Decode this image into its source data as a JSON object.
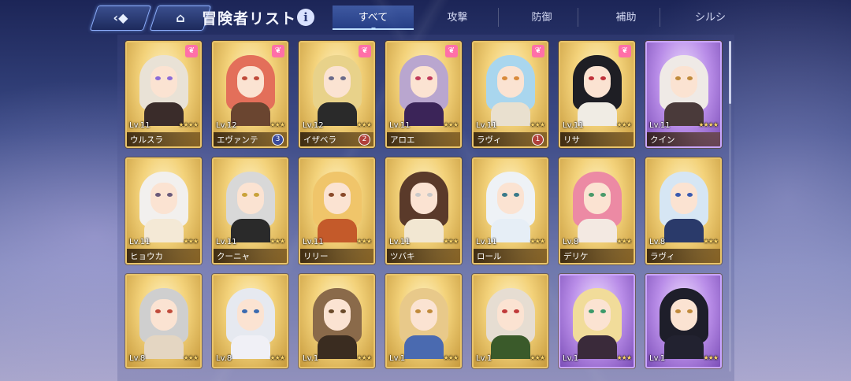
{
  "header": {
    "back_icon": "back-arrow-icon",
    "home_icon": "home-icon",
    "title": "冒険者リスト",
    "info_label": "i"
  },
  "tabs": [
    {
      "label": "すべて",
      "active": true
    },
    {
      "label": "攻撃",
      "active": false
    },
    {
      "label": "防御",
      "active": false
    },
    {
      "label": "補助",
      "active": false
    },
    {
      "label": "シルシ",
      "active": false
    }
  ],
  "cards": [
    {
      "name": "ウルスラ",
      "level": "Lv.11",
      "stars": "★★★★",
      "frame": "gold",
      "paw": true,
      "badge": "",
      "hair": "#e9e2d6",
      "eye": "#8a6ad8",
      "outfit": "#3a2c2a"
    },
    {
      "name": "エヴァンテ",
      "level": "Lv.12",
      "stars": "★★★",
      "frame": "gold",
      "paw": true,
      "badge": "3",
      "badge_color": "#3a4a9a",
      "hair": "#e36f5a",
      "eye": "#c04a3a",
      "outfit": "#6a4530"
    },
    {
      "name": "イザベラ",
      "level": "Lv.12",
      "stars": "★★★",
      "frame": "gold",
      "paw": true,
      "badge": "2",
      "badge_color": "#b0403a",
      "hair": "#e8d28a",
      "eye": "#6a6a8a",
      "outfit": "#2a2a2a"
    },
    {
      "name": "アロエ",
      "level": "Lv.11",
      "stars": "★★★",
      "frame": "gold",
      "paw": true,
      "badge": "",
      "hair": "#b9a6cf",
      "eye": "#c23a5a",
      "outfit": "#3b2458"
    },
    {
      "name": "ラヴィ",
      "level": "Lv.11",
      "stars": "★★★",
      "frame": "gold",
      "paw": true,
      "badge": "1",
      "badge_color": "#b0403a",
      "hair": "#a9d6ee",
      "eye": "#d98a3a",
      "outfit": "#e9e0cf"
    },
    {
      "name": "リサ",
      "level": "Lv.11",
      "stars": "★★★",
      "frame": "gold",
      "paw": true,
      "badge": "",
      "hair": "#1e1e24",
      "eye": "#c0303a",
      "outfit": "#f0ece4"
    },
    {
      "name": "クイン",
      "level": "Lv.11",
      "stars": "★★★★",
      "frame": "purple",
      "paw": false,
      "badge": "",
      "hair": "#efeae6",
      "eye": "#c08a3a",
      "outfit": "#4a3a3a"
    },
    {
      "name": "ヒョウカ",
      "level": "Lv.11",
      "stars": "★★★",
      "frame": "gold",
      "paw": false,
      "badge": "",
      "hair": "#f2f0ee",
      "eye": "#6a5a7a",
      "outfit": "#f4e9d6"
    },
    {
      "name": "クーニャ",
      "level": "Lv.11",
      "stars": "★★★",
      "frame": "gold",
      "paw": false,
      "badge": "",
      "hair": "#d8d8d8",
      "eye": "#c9a23a",
      "outfit": "#2a2a2a"
    },
    {
      "name": "リリー",
      "level": "Lv.11",
      "stars": "★★★",
      "frame": "gold",
      "paw": false,
      "badge": "",
      "hair": "#f0c56a",
      "eye": "#8a4a2a",
      "outfit": "#c45a2a"
    },
    {
      "name": "ツバキ",
      "level": "Lv.11",
      "stars": "★★★",
      "frame": "gold",
      "paw": false,
      "badge": "",
      "hair": "#5a3a2a",
      "eye": "#c9c9c9",
      "outfit": "#f2e7d2"
    },
    {
      "name": "ロール",
      "level": "Lv.11",
      "stars": "★★★",
      "frame": "gold",
      "paw": false,
      "badge": "",
      "hair": "#eef2f6",
      "eye": "#3a7a8a",
      "outfit": "#e6eef6"
    },
    {
      "name": "デリケ",
      "level": "Lv.8",
      "stars": "★★★",
      "frame": "gold",
      "paw": false,
      "badge": "",
      "hair": "#ec8aa4",
      "eye": "#4a9a6a",
      "outfit": "#f3e9e2"
    },
    {
      "name": "ラヴィ",
      "level": "Lv.8",
      "stars": "★★★",
      "frame": "gold",
      "paw": false,
      "badge": "",
      "hair": "#d6e6f4",
      "eye": "#3a5ab0",
      "outfit": "#2a3a6a"
    },
    {
      "name": "",
      "level": "Lv.8",
      "stars": "★★★",
      "frame": "gold",
      "paw": false,
      "badge": "",
      "hair": "#cfcfcf",
      "eye": "#c04a3a",
      "outfit": "#e4d6c2"
    },
    {
      "name": "",
      "level": "Lv.8",
      "stars": "★★★",
      "frame": "gold",
      "paw": false,
      "badge": "",
      "hair": "#e6e9f0",
      "eye": "#3a6ab0",
      "outfit": "#f0f0f6"
    },
    {
      "name": "",
      "level": "Lv.1",
      "stars": "★★★",
      "frame": "gold",
      "paw": false,
      "badge": "",
      "hair": "#8a6a4a",
      "eye": "#6a4a2a",
      "outfit": "#3a2c20"
    },
    {
      "name": "",
      "level": "Lv.1",
      "stars": "★★★",
      "frame": "gold",
      "paw": false,
      "badge": "",
      "hair": "#e8c98a",
      "eye": "#c08a3a",
      "outfit": "#4a6ab0"
    },
    {
      "name": "",
      "level": "Lv.1",
      "stars": "★★★",
      "frame": "gold",
      "paw": false,
      "badge": "",
      "hair": "#e6ddd2",
      "eye": "#c03a3a",
      "outfit": "#3a5a2a"
    },
    {
      "name": "",
      "level": "Lv.1",
      "stars": "★★★",
      "frame": "purple",
      "paw": false,
      "badge": "",
      "hair": "#f1dc9a",
      "eye": "#3a9a6a",
      "outfit": "#3a2a3a"
    },
    {
      "name": "",
      "level": "Lv.1",
      "stars": "★★★",
      "frame": "purple",
      "paw": false,
      "badge": "",
      "hair": "#1e1e2a",
      "eye": "#c08a3a",
      "outfit": "#222230"
    }
  ]
}
